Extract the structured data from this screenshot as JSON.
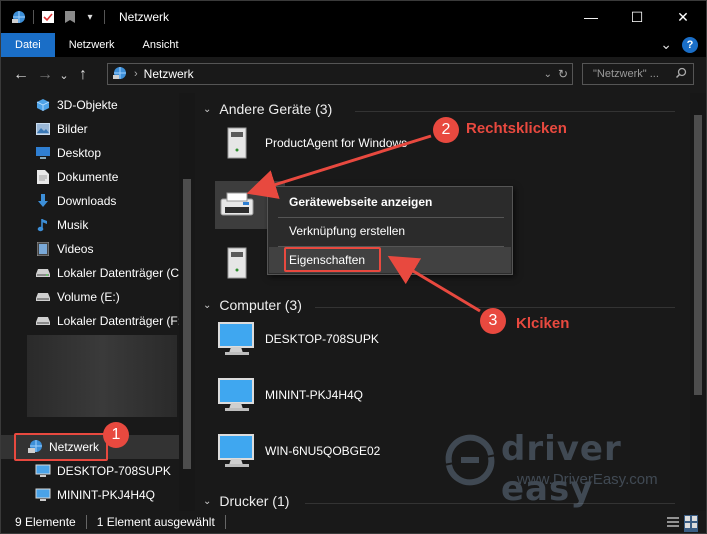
{
  "window": {
    "title": "Netzwerk",
    "minimize": "—",
    "maximize": "☐",
    "close": "✕"
  },
  "ribbon": {
    "tabs": [
      {
        "label": "Datei",
        "active": true
      },
      {
        "label": "Netzwerk",
        "active": false
      },
      {
        "label": "Ansicht",
        "active": false
      }
    ],
    "expand": "⌄",
    "help": "?"
  },
  "address": {
    "back": "←",
    "forward": "→",
    "recent": "⌄",
    "up": "↑",
    "chevron": "›",
    "path": "Netzwerk",
    "dropdown": "⌄",
    "refresh": "↻"
  },
  "search": {
    "placeholder": "\"Netzwerk\" ..."
  },
  "sidebar": {
    "items": [
      {
        "label": "3D-Objekte",
        "icon": "3d-objects-icon"
      },
      {
        "label": "Bilder",
        "icon": "pictures-icon"
      },
      {
        "label": "Desktop",
        "icon": "desktop-icon"
      },
      {
        "label": "Dokumente",
        "icon": "documents-icon"
      },
      {
        "label": "Downloads",
        "icon": "downloads-icon"
      },
      {
        "label": "Musik",
        "icon": "music-icon"
      },
      {
        "label": "Videos",
        "icon": "videos-icon"
      },
      {
        "label": "Lokaler Datenträger (C:)",
        "icon": "drive-icon"
      },
      {
        "label": "Volume (E:)",
        "icon": "drive-icon"
      },
      {
        "label": "Lokaler Datenträger (F:)",
        "icon": "drive-icon"
      }
    ],
    "network": {
      "label": "Netzwerk",
      "icon": "network-icon"
    },
    "network_items": [
      {
        "label": "DESKTOP-708SUPK",
        "icon": "computer-icon"
      },
      {
        "label": "MININT-PKJ4H4Q",
        "icon": "computer-icon"
      }
    ]
  },
  "content": {
    "groups": [
      {
        "title": "Andere Geräte (3)",
        "chevron": "⌄"
      },
      {
        "title": "Computer (3)",
        "chevron": "⌄"
      },
      {
        "title": "Drucker (1)",
        "chevron": "⌄"
      }
    ],
    "devices": [
      {
        "label": "ProductAgent for Windows",
        "icon": "media-server-icon"
      },
      {
        "label": "",
        "icon": "printer-icon"
      },
      {
        "label": "",
        "icon": "media-server-icon"
      }
    ],
    "computers": [
      {
        "label": "DESKTOP-708SUPK",
        "icon": "computer-icon"
      },
      {
        "label": "MININT-PKJ4H4Q",
        "icon": "computer-icon"
      },
      {
        "label": "WIN-6NU5QOBGE02",
        "icon": "computer-icon"
      }
    ]
  },
  "context_menu": {
    "items": [
      {
        "label": "Gerätewebseite anzeigen",
        "bold": true
      },
      {
        "label": "Verknüpfung erstellen",
        "bold": false
      },
      {
        "label": "Eigenschaften",
        "bold": false
      }
    ]
  },
  "status": {
    "count": "9 Elemente",
    "selection": "1 Element ausgewählt"
  },
  "annotations": {
    "step1": {
      "number": "1"
    },
    "step2": {
      "number": "2",
      "text": "Rechtsklicken"
    },
    "step3": {
      "number": "3",
      "text": "Klciken"
    },
    "color": "#e8493f"
  },
  "watermark": {
    "brand": "driver easy",
    "url": "www.DriverEasy.com"
  }
}
